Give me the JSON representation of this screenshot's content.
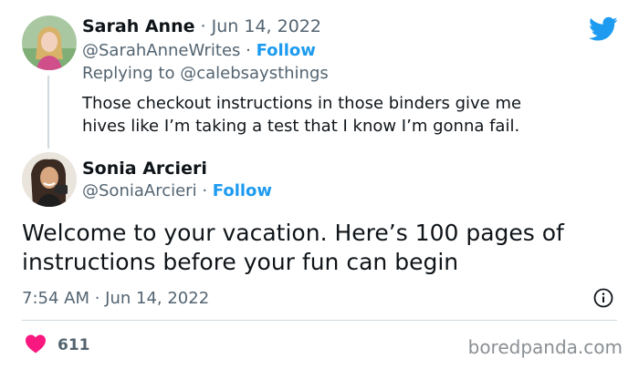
{
  "tweet1": {
    "author_name": "Sarah Anne",
    "separator": "·",
    "date": "Jun 14, 2022",
    "handle": "@SarahAnneWrites",
    "follow_label": "Follow",
    "replying_prefix": "Replying to",
    "replying_to": "@calebsaysthings",
    "text": "Those checkout instructions in those binders give me hives like I’m taking a test that I know I’m gonna fail."
  },
  "tweet2": {
    "author_name": "Sonia Arcieri",
    "handle": "@SoniaArcieri",
    "separator": "·",
    "follow_label": "Follow",
    "text": "Welcome to your vacation. Here’s 100 pages of instructions before your fun can begin",
    "timestamp": "7:54 AM · Jun 14, 2022",
    "like_count": "611"
  },
  "watermark": "boredpanda.com",
  "icons": {
    "brand": "twitter-bird-icon",
    "info": "info-icon",
    "like": "heart-icon"
  },
  "colors": {
    "accent": "#1d9bf0",
    "heart": "#f91880",
    "muted": "#536471"
  }
}
